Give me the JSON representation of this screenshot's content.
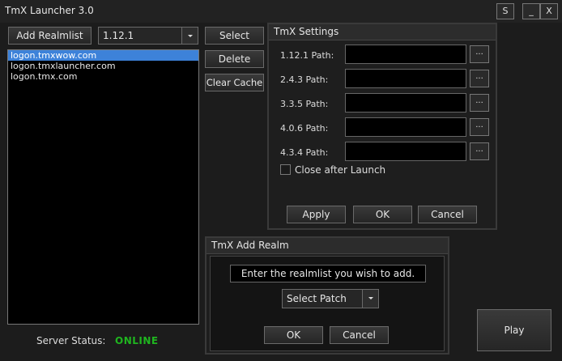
{
  "window": {
    "title": "TmX Launcher 3.0",
    "buttons": {
      "settings": "S",
      "minimize": "_",
      "close": "X"
    }
  },
  "realmlist": {
    "add_button": "Add Realmlist",
    "version_select": "1.12.1",
    "select_button": "Select",
    "delete_button": "Delete",
    "clear_cache_button": "Clear Cache",
    "items": [
      {
        "label": "logon.tmxwow.com",
        "selected": true
      },
      {
        "label": "logon.tmxlauncher.com",
        "selected": false
      },
      {
        "label": "logon.tmx.com",
        "selected": false
      }
    ]
  },
  "settings": {
    "title": "TmX Settings",
    "paths": [
      {
        "label": "1.12.1 Path:",
        "value": ""
      },
      {
        "label": "2.4.3 Path:",
        "value": ""
      },
      {
        "label": "3.3.5 Path:",
        "value": ""
      },
      {
        "label": "4.0.6 Path:",
        "value": ""
      },
      {
        "label": "4.3.4 Path:",
        "value": ""
      }
    ],
    "browse_label": "...",
    "close_after_launch": {
      "label": "Close after Launch",
      "checked": false
    },
    "apply_button": "Apply",
    "ok_button": "OK",
    "cancel_button": "Cancel"
  },
  "add_realm": {
    "title": "TmX Add Realm",
    "prompt": "Enter the realmlist you wish to add.",
    "patch_select": "Select Patch",
    "ok_button": "OK",
    "cancel_button": "Cancel"
  },
  "status": {
    "label": "Server Status:",
    "value": "ONLINE",
    "color": "#1fb51f"
  },
  "play_button": "Play"
}
